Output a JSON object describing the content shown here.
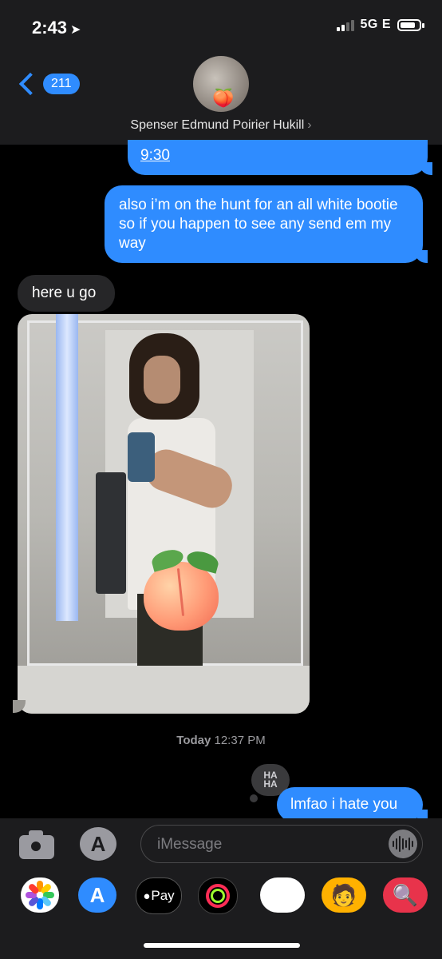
{
  "status_bar": {
    "time": "2:43",
    "network": "5G E"
  },
  "header": {
    "back_count": "211",
    "contact_name": "Spenser Edmund Poirier Hukill"
  },
  "messages": [
    {
      "type": "sent",
      "text": "9:30"
    },
    {
      "type": "sent",
      "text": "also i’m on the hunt for an all white bootie so if you happen to see any send em my way"
    },
    {
      "type": "received",
      "text": "here u go"
    },
    {
      "type": "received_image",
      "content": "mirror selfie with peach emoji"
    }
  ],
  "timestamp": {
    "day": "Today",
    "time": "12:37 PM"
  },
  "tapback": {
    "label": "HA HA"
  },
  "last_message": {
    "text": "lmfao i hate you"
  },
  "input": {
    "placeholder": "iMessage"
  },
  "app_drawer": {
    "pay_label": "Pay"
  }
}
